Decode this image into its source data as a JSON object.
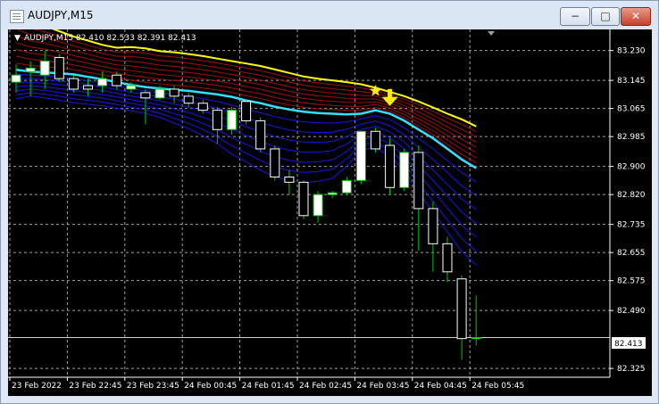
{
  "window": {
    "title": "AUDJPY,M15",
    "min_glyph": "−",
    "max_glyph": "□",
    "close_glyph": "✕"
  },
  "chart_info": {
    "marker": "▼",
    "label": "AUDJPY,M15  82.410 82.533 82.391 82.413"
  },
  "current_price": "82.413",
  "colors": {
    "background": "#000000",
    "grid": "#c8c8c8",
    "bull_body": "#ffffff",
    "wick": "#00c800",
    "upper_band": "#ffff00",
    "mid_band": "#33e0ff",
    "red_bands": "#b01010",
    "blue_bands": "#1a1aff",
    "signal_arrow": "#ffee00",
    "signal_star": "#ffee00"
  },
  "chart_data": {
    "type": "candlestick",
    "symbol": "AUDJPY",
    "timeframe": "M15",
    "ylim": [
      82.3,
      83.29
    ],
    "y_ticks": [
      "83.230",
      "83.145",
      "83.065",
      "82.985",
      "82.900",
      "82.820",
      "82.735",
      "82.655",
      "82.575",
      "82.490",
      "82.325"
    ],
    "x_ticks": [
      "23 Feb 2022",
      "23 Feb 22:45",
      "23 Feb 23:45",
      "24 Feb 00:45",
      "24 Feb 01:45",
      "24 Feb 02:45",
      "24 Feb 03:45",
      "24 Feb 04:45",
      "24 Feb 05:45"
    ],
    "grid": true,
    "candles": [
      {
        "o": 83.14,
        "h": 83.19,
        "l": 83.11,
        "c": 83.16
      },
      {
        "o": 83.17,
        "h": 83.2,
        "l": 83.1,
        "c": 83.18
      },
      {
        "o": 83.16,
        "h": 83.23,
        "l": 83.12,
        "c": 83.2
      },
      {
        "o": 83.21,
        "h": 83.22,
        "l": 83.14,
        "c": 83.15
      },
      {
        "o": 83.15,
        "h": 83.16,
        "l": 83.11,
        "c": 83.12
      },
      {
        "o": 83.13,
        "h": 83.15,
        "l": 83.1,
        "c": 83.12
      },
      {
        "o": 83.13,
        "h": 83.17,
        "l": 83.11,
        "c": 83.15
      },
      {
        "o": 83.16,
        "h": 83.17,
        "l": 83.12,
        "c": 83.13
      },
      {
        "o": 83.12,
        "h": 83.14,
        "l": 83.11,
        "c": 83.13
      },
      {
        "o": 83.11,
        "h": 83.12,
        "l": 83.02,
        "c": 83.095
      },
      {
        "o": 83.095,
        "h": 83.13,
        "l": 83.09,
        "c": 83.12
      },
      {
        "o": 83.12,
        "h": 83.13,
        "l": 83.08,
        "c": 83.1
      },
      {
        "o": 83.1,
        "h": 83.11,
        "l": 83.07,
        "c": 83.08
      },
      {
        "o": 83.08,
        "h": 83.09,
        "l": 83.05,
        "c": 83.06
      },
      {
        "o": 83.06,
        "h": 83.07,
        "l": 82.965,
        "c": 83.005
      },
      {
        "o": 83.005,
        "h": 83.07,
        "l": 82.99,
        "c": 83.06
      },
      {
        "o": 83.085,
        "h": 83.09,
        "l": 83.02,
        "c": 83.03
      },
      {
        "o": 83.03,
        "h": 83.04,
        "l": 82.94,
        "c": 82.95
      },
      {
        "o": 82.95,
        "h": 82.96,
        "l": 82.86,
        "c": 82.87
      },
      {
        "o": 82.87,
        "h": 82.89,
        "l": 82.82,
        "c": 82.855
      },
      {
        "o": 82.855,
        "h": 82.86,
        "l": 82.75,
        "c": 82.76
      },
      {
        "o": 82.76,
        "h": 82.83,
        "l": 82.74,
        "c": 82.82
      },
      {
        "o": 82.82,
        "h": 82.83,
        "l": 82.81,
        "c": 82.825
      },
      {
        "o": 82.825,
        "h": 82.87,
        "l": 82.82,
        "c": 82.86
      },
      {
        "o": 82.86,
        "h": 82.95,
        "l": 82.85,
        "c": 83.0
      },
      {
        "o": 83.0,
        "h": 83.01,
        "l": 82.94,
        "c": 82.95
      },
      {
        "o": 82.96,
        "h": 82.98,
        "l": 82.82,
        "c": 82.84
      },
      {
        "o": 82.84,
        "h": 82.95,
        "l": 82.83,
        "c": 82.94
      },
      {
        "o": 82.94,
        "h": 82.96,
        "l": 82.66,
        "c": 82.78
      },
      {
        "o": 82.78,
        "h": 82.8,
        "l": 82.6,
        "c": 82.68
      },
      {
        "o": 82.68,
        "h": 82.7,
        "l": 82.57,
        "c": 82.6
      },
      {
        "o": 82.58,
        "h": 82.59,
        "l": 82.35,
        "c": 82.41
      },
      {
        "o": 82.41,
        "h": 82.533,
        "l": 82.391,
        "c": 82.413
      }
    ],
    "upper_band": [
      83.33,
      83.31,
      83.3,
      83.285,
      83.27,
      83.258,
      83.246,
      83.238,
      83.24,
      83.236,
      83.228,
      83.225,
      83.22,
      83.214,
      83.207,
      83.2,
      83.193,
      83.186,
      83.176,
      83.166,
      83.156,
      83.15,
      83.145,
      83.14,
      83.134,
      83.124,
      83.112,
      83.1,
      83.085,
      83.068,
      83.05,
      83.034,
      83.014
    ],
    "mid_band": [
      83.175,
      83.17,
      83.168,
      83.165,
      83.162,
      83.155,
      83.148,
      83.14,
      83.132,
      83.126,
      83.122,
      83.118,
      83.115,
      83.11,
      83.105,
      83.098,
      83.088,
      83.08,
      83.07,
      83.062,
      83.056,
      83.052,
      83.05,
      83.048,
      83.05,
      83.06,
      83.05,
      83.03,
      83.005,
      82.98,
      82.95,
      82.92,
      82.895
    ],
    "lower_band": [
      83.08,
      83.09,
      83.085,
      83.078,
      83.07,
      83.066,
      83.062,
      83.055,
      83.048,
      83.04,
      83.028,
      83.01,
      82.992,
      82.97,
      82.945,
      82.912,
      82.888,
      82.862,
      82.842,
      82.83,
      82.825,
      82.83,
      82.84,
      82.88,
      82.932,
      82.938,
      82.912,
      82.87,
      82.8,
      82.74,
      82.68,
      82.62,
      82.58
    ],
    "signals": [
      {
        "type": "sell_arrow",
        "bar": 26,
        "price": 83.09
      },
      {
        "type": "star",
        "bar": 25,
        "price": 83.115
      }
    ]
  }
}
